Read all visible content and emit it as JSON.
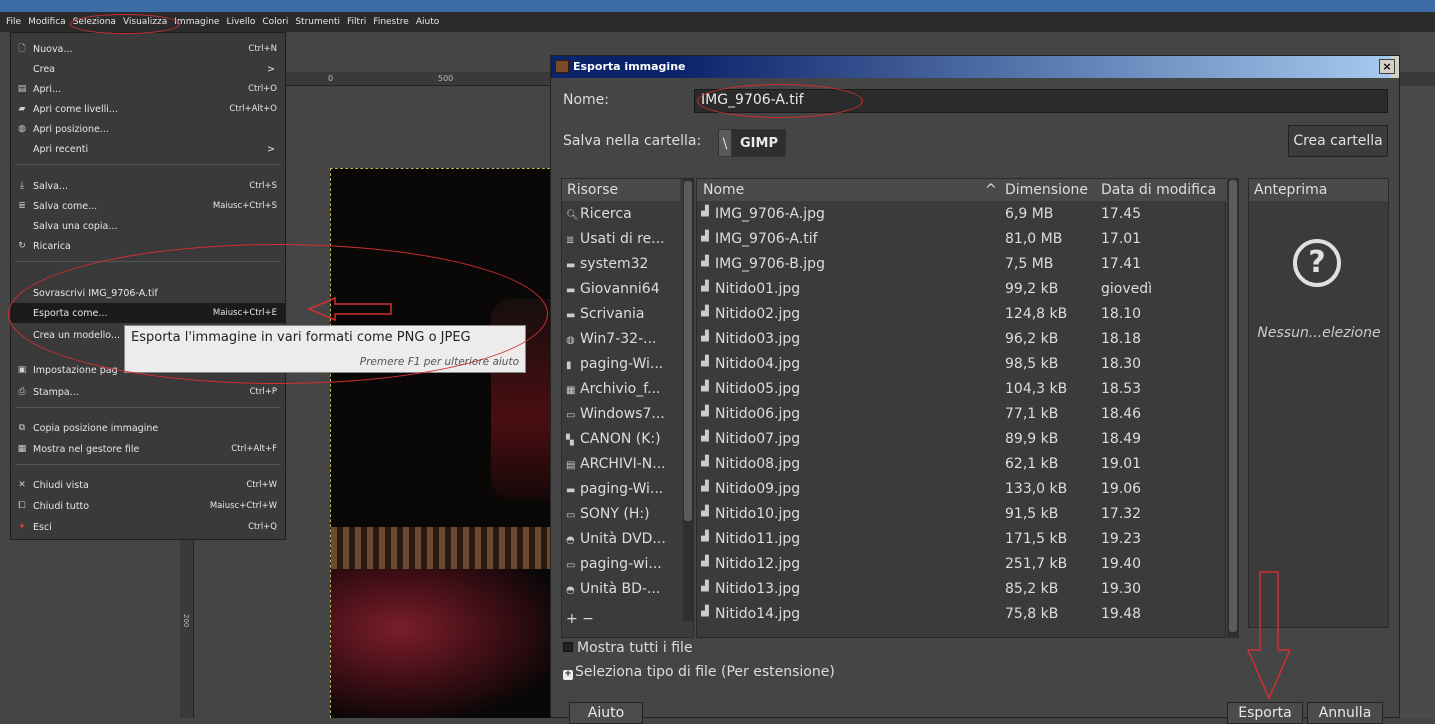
{
  "menubar": [
    "File",
    "Modifica",
    "Seleziona",
    "Visualizza",
    "Immagine",
    "Livello",
    "Colori",
    "Strumenti",
    "Filtri",
    "Finestre",
    "Aiuto"
  ],
  "ruler": {
    "t0": "0",
    "t500": "500",
    "left": "200"
  },
  "file_menu": {
    "nuova": {
      "label": "Nuova...",
      "shortcut": "Ctrl+N"
    },
    "crea": {
      "label": "Crea"
    },
    "apri": {
      "label": "Apri...",
      "shortcut": "Ctrl+O"
    },
    "apri_livelli": {
      "label": "Apri come livelli...",
      "shortcut": "Ctrl+Alt+O"
    },
    "apri_posizione": {
      "label": "Apri posizione..."
    },
    "apri_recenti": {
      "label": "Apri recenti"
    },
    "salva": {
      "label": "Salva...",
      "shortcut": "Ctrl+S"
    },
    "salva_come": {
      "label": "Salva come...",
      "shortcut": "Maiusc+Ctrl+S"
    },
    "salva_copia": {
      "label": "Salva una copia..."
    },
    "ricarica": {
      "label": "Ricarica"
    },
    "sovrascrivi": {
      "label": "Sovrascrivi IMG_9706-A.tif"
    },
    "esporta_come": {
      "label": "Esporta come...",
      "shortcut": "Maiusc+Ctrl+E"
    },
    "crea_modello": {
      "label": "Crea un modello..."
    },
    "impostazione": {
      "label": "Impostazione pag"
    },
    "stampa": {
      "label": "Stampa...",
      "shortcut": "Ctrl+P"
    },
    "copia_posizione": {
      "label": "Copia posizione immagine"
    },
    "mostra_gestore": {
      "label": "Mostra nel gestore file",
      "shortcut": "Ctrl+Alt+F"
    },
    "chiudi_vista": {
      "label": "Chiudi vista",
      "shortcut": "Ctrl+W"
    },
    "chiudi_tutto": {
      "label": "Chiudi tutto",
      "shortcut": "Maiusc+Ctrl+W"
    },
    "esci": {
      "label": "Esci",
      "shortcut": "Ctrl+Q"
    }
  },
  "tooltip": {
    "text": "Esporta l'immagine in vari formati come PNG o JPEG",
    "hint": "Premere F1 per ulteriore aiuto"
  },
  "dialog": {
    "title": "Esporta immagine",
    "close": "×",
    "name_label": "Nome:",
    "name_value": "IMG_9706-A.tif",
    "folder_label": "Salva nella cartella:",
    "folder_sep": "\\",
    "folder_name": "GIMP",
    "create_folder": "Crea cartella",
    "places_header": "Risorse",
    "places": [
      {
        "icon": "search-icon",
        "glyph": "🔍︎",
        "label": "Ricerca"
      },
      {
        "icon": "recent-icon",
        "glyph": "≣",
        "label": "Usati di re..."
      },
      {
        "icon": "folder-icon",
        "glyph": "▬",
        "label": "system32"
      },
      {
        "icon": "folder-icon",
        "glyph": "▬",
        "label": "Giovanni64"
      },
      {
        "icon": "folder-icon",
        "glyph": "▬",
        "label": "Scrivania"
      },
      {
        "icon": "drive-icon",
        "glyph": "◍",
        "label": "Win7-32-..."
      },
      {
        "icon": "file-icon",
        "glyph": "▮",
        "label": "paging-Wi..."
      },
      {
        "icon": "archive-icon",
        "glyph": "▦",
        "label": "Archivio_f..."
      },
      {
        "icon": "drive-icon",
        "glyph": "▭",
        "label": "Windows7..."
      },
      {
        "icon": "drive-icon",
        "glyph": "▚",
        "label": "CANON (K:)"
      },
      {
        "icon": "drive-icon",
        "glyph": "▤",
        "label": "ARCHIVI-N..."
      },
      {
        "icon": "drive-icon",
        "glyph": "▬",
        "label": "paging-Wi..."
      },
      {
        "icon": "drive-icon",
        "glyph": "▭",
        "label": "SONY (H:)"
      },
      {
        "icon": "disc-icon",
        "glyph": "◓",
        "label": "Unità DVD..."
      },
      {
        "icon": "drive-icon",
        "glyph": "▭",
        "label": "paging-wi..."
      },
      {
        "icon": "disc-icon",
        "glyph": "◓",
        "label": "Unità BD-..."
      }
    ],
    "places_footer": "+ −",
    "columns": {
      "name": "Nome",
      "sort": "^",
      "size": "Dimensione",
      "date": "Data di modifica"
    },
    "files": [
      {
        "name": "IMG_9706-A.jpg",
        "size": "6,9 MB",
        "date": "17.45"
      },
      {
        "name": "IMG_9706-A.tif",
        "size": "81,0 MB",
        "date": "17.01"
      },
      {
        "name": "IMG_9706-B.jpg",
        "size": "7,5 MB",
        "date": "17.41"
      },
      {
        "name": "Nitido01.jpg",
        "size": "99,2 kB",
        "date": "giovedì"
      },
      {
        "name": "Nitido02.jpg",
        "size": "124,8 kB",
        "date": "18.10"
      },
      {
        "name": "Nitido03.jpg",
        "size": "96,2 kB",
        "date": "18.18"
      },
      {
        "name": "Nitido04.jpg",
        "size": "98,5 kB",
        "date": "18.30"
      },
      {
        "name": "Nitido05.jpg",
        "size": "104,3 kB",
        "date": "18.53"
      },
      {
        "name": "Nitido06.jpg",
        "size": "77,1 kB",
        "date": "18.46"
      },
      {
        "name": "Nitido07.jpg",
        "size": "89,9 kB",
        "date": "18.49"
      },
      {
        "name": "Nitido08.jpg",
        "size": "62,1 kB",
        "date": "19.01"
      },
      {
        "name": "Nitido09.jpg",
        "size": "133,0 kB",
        "date": "19.06"
      },
      {
        "name": "Nitido10.jpg",
        "size": "91,5 kB",
        "date": "17.32"
      },
      {
        "name": "Nitido11.jpg",
        "size": "171,5 kB",
        "date": "19.23"
      },
      {
        "name": "Nitido12.jpg",
        "size": "251,7 kB",
        "date": "19.40"
      },
      {
        "name": "Nitido13.jpg",
        "size": "85,2 kB",
        "date": "19.30"
      },
      {
        "name": "Nitido14.jpg",
        "size": "75,8 kB",
        "date": "19.48"
      }
    ],
    "preview_header": "Anteprima",
    "preview_none": "Nessun...elezione",
    "show_all": "Mostra tutti i file",
    "filetype": "Seleziona tipo di file (Per estensione)",
    "help": "Aiuto",
    "export": "Esporta",
    "cancel": "Annulla"
  },
  "colors": {
    "annotation": "#d03030",
    "menu_bg": "#3a3a3a",
    "titlebar": "#0a246a"
  }
}
